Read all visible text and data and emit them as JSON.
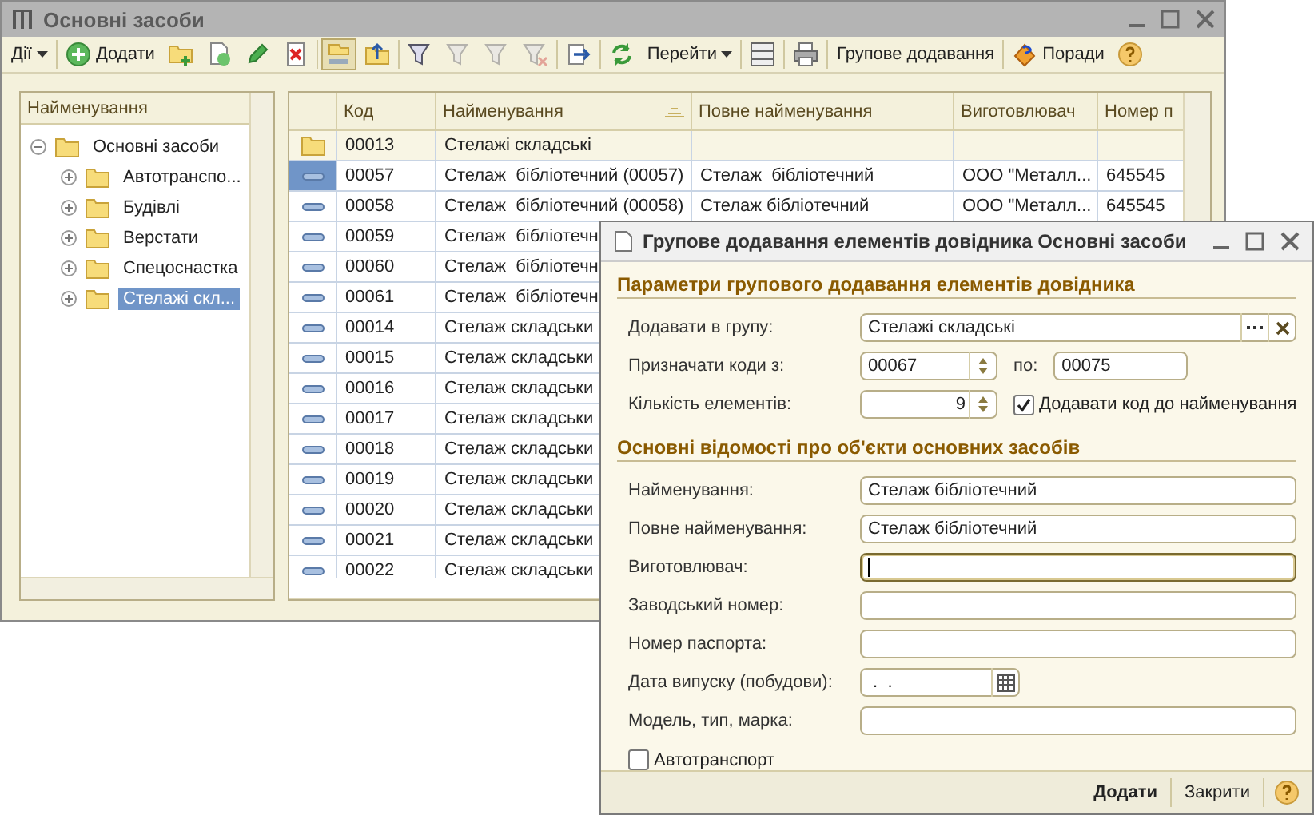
{
  "main_window": {
    "title": "Основні засоби",
    "toolbar": [
      {
        "kind": "menu",
        "label": "Дії"
      },
      {
        "kind": "separator"
      },
      {
        "kind": "iconbutton",
        "label": "Додати"
      },
      {
        "kind": "tool",
        "pressed": false,
        "disabled": false
      },
      {
        "kind": "tool",
        "pressed": false,
        "disabled": false
      },
      {
        "kind": "tool",
        "pressed": false,
        "disabled": false
      },
      {
        "kind": "tool",
        "pressed": false,
        "disabled": false
      },
      {
        "kind": "separator"
      },
      {
        "kind": "tool",
        "pressed": true,
        "disabled": false
      },
      {
        "kind": "tool",
        "pressed": false,
        "disabled": false
      },
      {
        "kind": "separator"
      },
      {
        "kind": "tool",
        "pressed": false,
        "disabled": false
      },
      {
        "kind": "tool",
        "pressed": false,
        "disabled": true
      },
      {
        "kind": "tool",
        "pressed": false,
        "disabled": true
      },
      {
        "kind": "tool",
        "pressed": false,
        "disabled": true
      },
      {
        "kind": "separator"
      },
      {
        "kind": "tool",
        "pressed": false,
        "disabled": false
      },
      {
        "kind": "separator"
      },
      {
        "kind": "tool",
        "pressed": false,
        "disabled": false
      },
      {
        "kind": "menu",
        "label": "Перейти"
      },
      {
        "kind": "separator"
      },
      {
        "kind": "tool",
        "pressed": false,
        "disabled": false
      },
      {
        "kind": "separator"
      },
      {
        "kind": "tool",
        "pressed": false,
        "disabled": false
      },
      {
        "kind": "separator"
      },
      {
        "kind": "button",
        "label": "Групове додавання"
      },
      {
        "kind": "separator"
      },
      {
        "kind": "iconbutton",
        "label": "Поради"
      },
      {
        "kind": "tool",
        "pressed": false,
        "disabled": false
      }
    ],
    "tree": {
      "header": "Найменування",
      "items": [
        {
          "label": "Основні засоби",
          "expanded": true,
          "selected": false,
          "children": [
            {
              "label": "Автотранспо...",
              "expanded": false,
              "selected": false
            },
            {
              "label": "Будівлі",
              "expanded": false,
              "selected": false
            },
            {
              "label": "Верстати",
              "expanded": false,
              "selected": false
            },
            {
              "label": "Спецоснастка",
              "expanded": false,
              "selected": false
            },
            {
              "label": "Стелажі скл...",
              "expanded": false,
              "selected": true
            }
          ]
        }
      ]
    },
    "table": {
      "columns": [
        {
          "label": "Код",
          "sorted": false
        },
        {
          "label": "Найменування",
          "sorted": true
        },
        {
          "label": "Повне найменування",
          "sorted": false
        },
        {
          "label": "Виготовлювач",
          "sorted": false
        },
        {
          "label": "Номер п",
          "sorted": false
        }
      ],
      "rows": [
        {
          "kind": "group",
          "selected": false,
          "code": "00013",
          "name": "Стелажі складські"
        },
        {
          "kind": "item",
          "selected": true,
          "code": "00057",
          "name": "Стелаж  бібліотечний (00057)",
          "full_name": "Стелаж  бібліотечний",
          "maker": "ООО \"Металл...",
          "number": "645545"
        },
        {
          "kind": "item",
          "selected": false,
          "code": "00058",
          "name": "Стелаж  бібліотечний (00058)",
          "full_name": "Стелаж бібліотечний",
          "maker": "ООО \"Металл...",
          "number": "645545"
        },
        {
          "kind": "item",
          "selected": false,
          "code": "00059",
          "name": "Стелаж  бібліотечн"
        },
        {
          "kind": "item",
          "selected": false,
          "code": "00060",
          "name": "Стелаж  бібліотечн"
        },
        {
          "kind": "item",
          "selected": false,
          "code": "00061",
          "name": "Стелаж  бібліотечн"
        },
        {
          "kind": "item",
          "selected": false,
          "code": "00014",
          "name": "Стелаж складськи"
        },
        {
          "kind": "item",
          "selected": false,
          "code": "00015",
          "name": "Стелаж складськи"
        },
        {
          "kind": "item",
          "selected": false,
          "code": "00016",
          "name": "Стелаж складськи"
        },
        {
          "kind": "item",
          "selected": false,
          "code": "00017",
          "name": "Стелаж складськи"
        },
        {
          "kind": "item",
          "selected": false,
          "code": "00018",
          "name": "Стелаж складськи"
        },
        {
          "kind": "item",
          "selected": false,
          "code": "00019",
          "name": "Стелаж складськи"
        },
        {
          "kind": "item",
          "selected": false,
          "code": "00020",
          "name": "Стелаж складськи"
        },
        {
          "kind": "item",
          "selected": false,
          "code": "00021",
          "name": "Стелаж складськи"
        },
        {
          "kind": "item",
          "selected": false,
          "code": "00022",
          "name": "Стелаж складськи"
        }
      ]
    }
  },
  "dialog": {
    "title": "Групове додавання елементів довідника Основні засоби",
    "params_section": "Параметри групового додавання елементів довідника",
    "group": {
      "label": "Додавати в групу:",
      "value": "Стелажі складські"
    },
    "codes": {
      "label": "Призначати коди з:",
      "value": "00067",
      "to_label": "по:",
      "to_value": "00075"
    },
    "count": {
      "label": "Кількість елементів:",
      "value": "9"
    },
    "add_code": {
      "label": "Додавати код до найменування",
      "checked": true
    },
    "details_section": "Основні відомості про об'єкти основних засобів",
    "fields": [
      {
        "kind": "text",
        "label": "Найменування:",
        "value": "Стелаж бібліотечний",
        "focused": false
      },
      {
        "kind": "text",
        "label": "Повне найменування:",
        "value": "Стелаж бібліотечний",
        "focused": false
      },
      {
        "kind": "text",
        "label": "Виготовлювач:",
        "focused": true
      },
      {
        "kind": "text",
        "label": "Заводський номер:",
        "focused": false
      },
      {
        "kind": "text",
        "label": "Номер паспорта:",
        "focused": false
      },
      {
        "kind": "date",
        "label": "Дата випуску (побудови):",
        "value": " .  .",
        "focused": false
      },
      {
        "kind": "text",
        "label": "Модель, тип, марка:",
        "focused": false
      }
    ],
    "vehicle": {
      "label": "Автотранспорт",
      "checked": false
    },
    "buttons": [
      {
        "label": "Додати",
        "default": true
      },
      {
        "label": "Закрити",
        "default": false
      }
    ]
  }
}
